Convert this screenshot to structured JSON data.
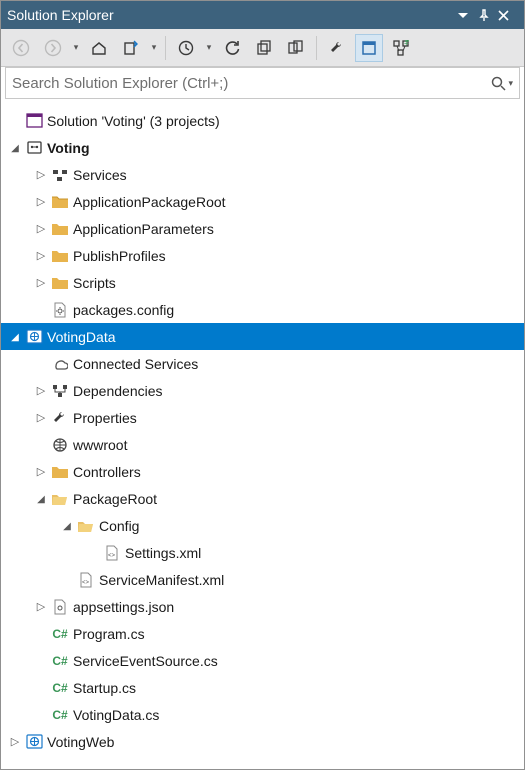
{
  "titlebar": {
    "title": "Solution Explorer"
  },
  "search": {
    "placeholder": "Search Solution Explorer (Ctrl+;)"
  },
  "tree": {
    "solution_label": "Solution 'Voting' (3 projects)",
    "voting": {
      "label": "Voting",
      "services": "Services",
      "app_pkg_root": "ApplicationPackageRoot",
      "app_params": "ApplicationParameters",
      "publish_profiles": "PublishProfiles",
      "scripts": "Scripts",
      "packages_config": "packages.config"
    },
    "votingdata": {
      "label": "VotingData",
      "connected_services": "Connected Services",
      "dependencies": "Dependencies",
      "properties": "Properties",
      "wwwroot": "wwwroot",
      "controllers": "Controllers",
      "packageroot": {
        "label": "PackageRoot",
        "config": {
          "label": "Config",
          "settings_xml": "Settings.xml"
        },
        "service_manifest": "ServiceManifest.xml"
      },
      "appsettings": "appsettings.json",
      "program_cs": "Program.cs",
      "service_event_source": "ServiceEventSource.cs",
      "startup_cs": "Startup.cs",
      "votingdata_cs": "VotingData.cs"
    },
    "votingweb": {
      "label": "VotingWeb"
    }
  }
}
